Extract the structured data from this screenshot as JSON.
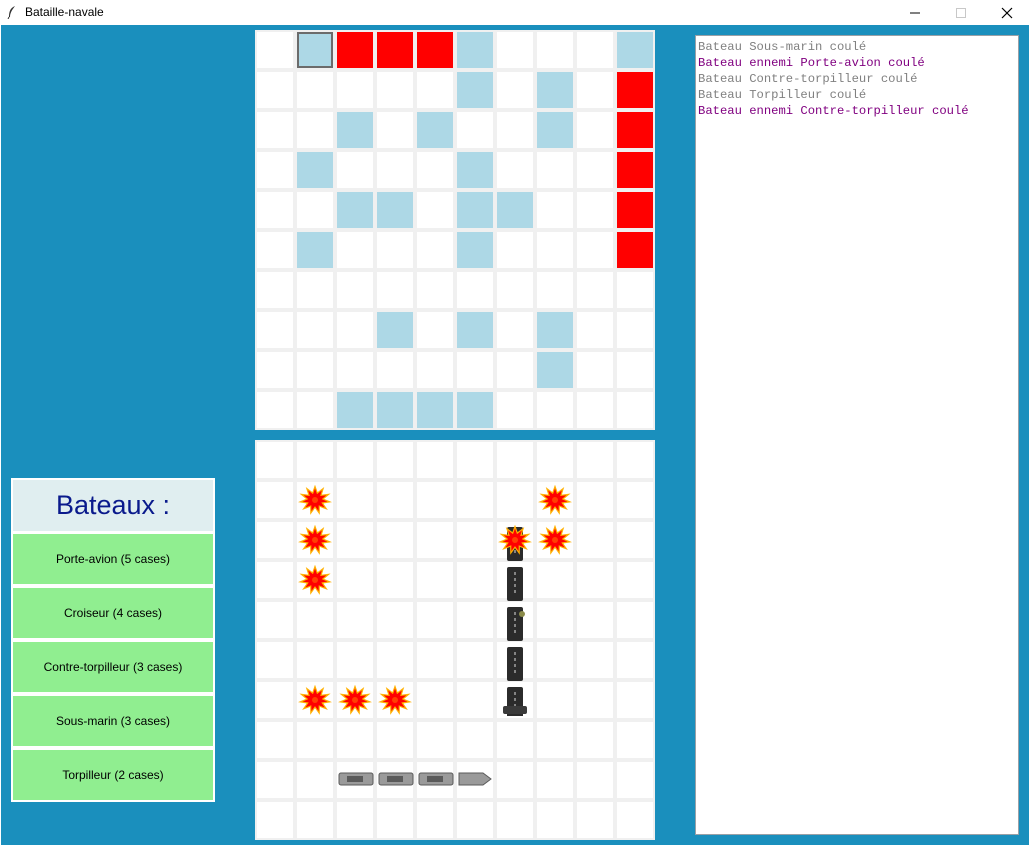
{
  "window": {
    "title": "Bataille-navale"
  },
  "colors": {
    "background": "#1a8fbd",
    "miss": "#add8e6",
    "hit": "#ff0000",
    "boat_button": "#90ee90",
    "log_player": "#808080",
    "log_enemy": "#800080"
  },
  "boats_panel": {
    "title": "Bateaux :",
    "items": [
      {
        "label": "Porte-avion (5 cases)"
      },
      {
        "label": "Croiseur (4 cases)"
      },
      {
        "label": "Contre-torpilleur (3 cases)"
      },
      {
        "label": "Sous-marin (3 cases)"
      },
      {
        "label": "Torpilleur (2 cases)"
      }
    ]
  },
  "log": [
    {
      "text": "Bateau Sous-marin coulé",
      "kind": "player"
    },
    {
      "text": "Bateau ennemi Porte-avion coulé",
      "kind": "enemy"
    },
    {
      "text": "Bateau Contre-torpilleur coulé",
      "kind": "player"
    },
    {
      "text": "Bateau Torpilleur coulé",
      "kind": "player"
    },
    {
      "text": "Bateau ennemi Contre-torpilleur coulé",
      "kind": "enemy"
    }
  ],
  "enemy_board": {
    "size": 10,
    "cursor": [
      1,
      0
    ],
    "hits": [
      [
        2,
        0
      ],
      [
        3,
        0
      ],
      [
        4,
        0
      ],
      [
        9,
        1
      ],
      [
        9,
        2
      ],
      [
        9,
        3
      ],
      [
        9,
        4
      ],
      [
        9,
        5
      ]
    ],
    "misses": [
      [
        1,
        0
      ],
      [
        5,
        0
      ],
      [
        9,
        0
      ],
      [
        5,
        1
      ],
      [
        7,
        1
      ],
      [
        2,
        2
      ],
      [
        4,
        2
      ],
      [
        7,
        2
      ],
      [
        1,
        3
      ],
      [
        5,
        3
      ],
      [
        2,
        4
      ],
      [
        3,
        4
      ],
      [
        5,
        4
      ],
      [
        6,
        4
      ],
      [
        1,
        5
      ],
      [
        5,
        5
      ],
      [
        3,
        7
      ],
      [
        5,
        7
      ],
      [
        7,
        7
      ],
      [
        7,
        8
      ],
      [
        2,
        9
      ],
      [
        3,
        9
      ],
      [
        4,
        9
      ],
      [
        5,
        9
      ]
    ]
  },
  "player_board": {
    "size": 10,
    "explosions": [
      [
        1,
        1
      ],
      [
        1,
        2
      ],
      [
        1,
        3
      ],
      [
        7,
        1
      ],
      [
        7,
        2
      ],
      [
        6,
        2
      ],
      [
        1,
        6
      ],
      [
        2,
        6
      ],
      [
        3,
        6
      ]
    ],
    "ships": [
      {
        "name": "Porte-avion",
        "col": 6,
        "row": 2,
        "length": 5,
        "orientation": "vertical"
      },
      {
        "name": "Croiseur",
        "col": 2,
        "row": 8,
        "length": 4,
        "orientation": "horizontal"
      }
    ]
  }
}
